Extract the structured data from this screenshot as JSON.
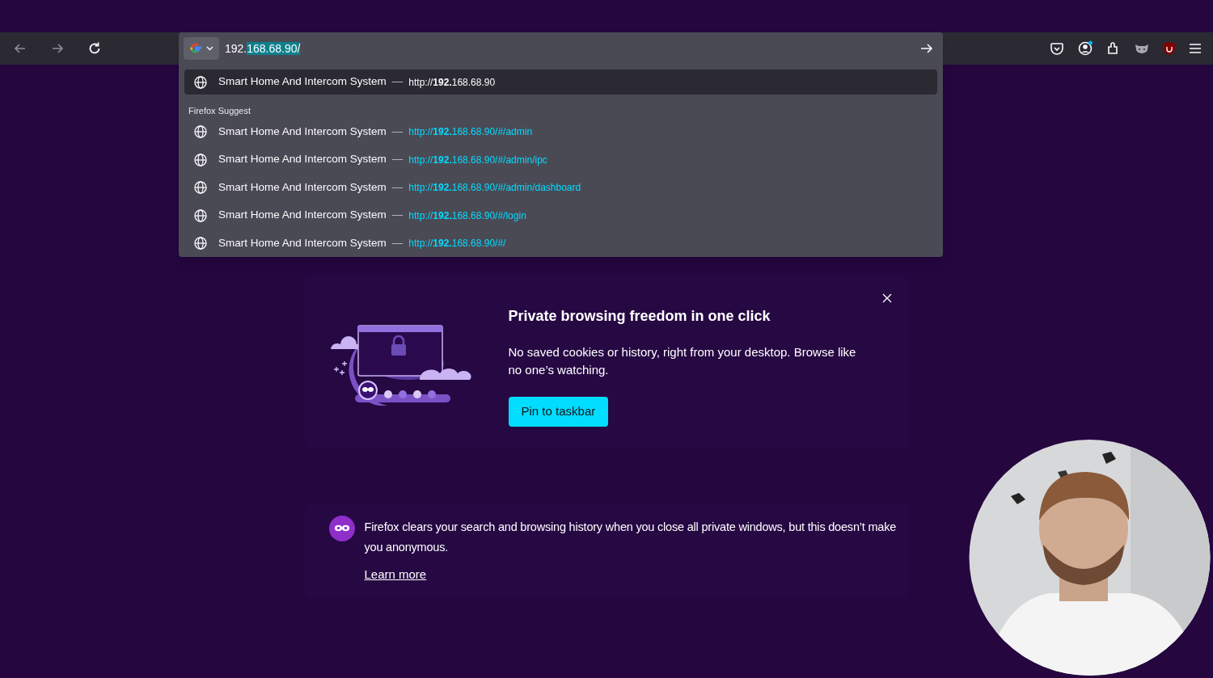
{
  "toolbar": {
    "nav_buttons": [
      {
        "kind": "back",
        "disabled": true
      },
      {
        "kind": "forward",
        "disabled": true
      },
      {
        "kind": "reload",
        "disabled": false
      }
    ]
  },
  "address_bar": {
    "typed_text": "192.",
    "selected_text": "168.68.90/"
  },
  "suggestions": [
    {
      "title": "Smart Home And Intercom System",
      "separator": "—",
      "url": "http://**192.**168.68.90",
      "selected": true
    }
  ],
  "suggest_group": {
    "heading": "Firefox Suggest",
    "items": [
      {
        "title": "Smart Home And Intercom System",
        "separator": "—",
        "url": "http://**192.**168.68.90/#/admin",
        "selected": false
      },
      {
        "title": "Smart Home And Intercom System",
        "separator": "—",
        "url": "http://**192.**168.68.90/#/admin/ipc",
        "selected": false
      },
      {
        "title": "Smart Home And Intercom System",
        "separator": "—",
        "url": "http://**192.**168.68.90/#/admin/dashboard",
        "selected": false
      },
      {
        "title": "Smart Home And Intercom System",
        "separator": "—",
        "url": "http://**192.**168.68.90/#/login",
        "selected": false
      },
      {
        "title": "Smart Home And Intercom System",
        "separator": "—",
        "url": "http://**192.**168.68.90/#/",
        "selected": false
      }
    ]
  },
  "promo": {
    "title": "Private browsing freedom in one click",
    "body": "No saved cookies or history, right from your desktop. Browse like no one’s watching.",
    "button": "Pin to taskbar"
  },
  "notice": {
    "text": "Firefox clears your search and browsing history when you close all private windows, but this doesn’t make you anonymous.",
    "link": "Learn more"
  }
}
